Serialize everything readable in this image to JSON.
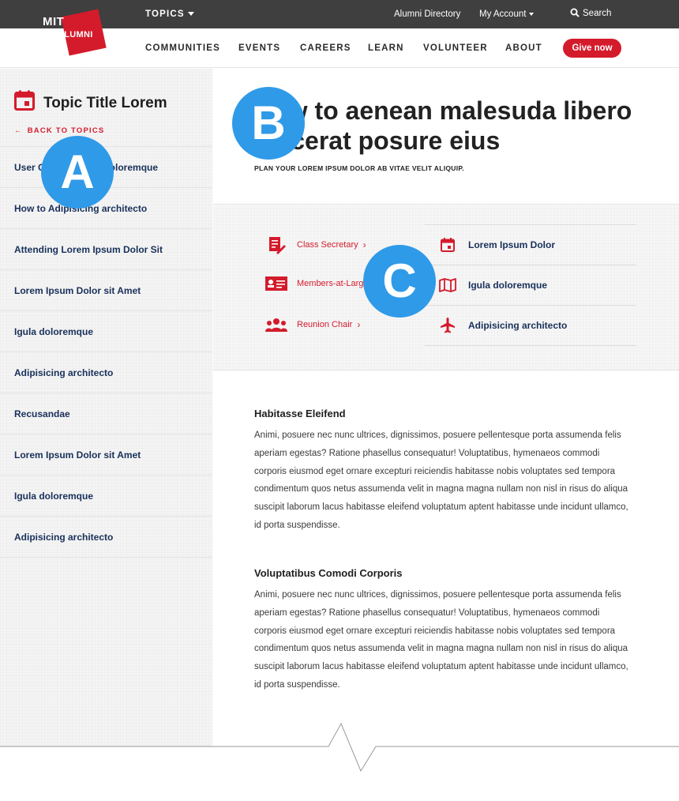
{
  "header": {
    "topics_label": "TOPICS",
    "alumni_directory": "Alumni Directory",
    "my_account": "My Account",
    "search": "Search",
    "logo_mit": "MIT",
    "logo_alumni": "ALUMNI"
  },
  "nav": {
    "items": [
      "COMMUNITIES",
      "EVENTS",
      "CAREERS",
      "LEARN",
      "VOLUNTEER",
      "ABOUT"
    ],
    "give_label": "Give now"
  },
  "sidebar": {
    "title": "Topic Title Lorem",
    "back": "BACK TO TOPICS",
    "items": [
      "User Guide to Igula doloremque",
      "How to Adipisicing architecto",
      "Attending Lorem Ipsum Dolor Sit",
      "Lorem Ipsum Dolor sit Amet",
      "Igula doloremque",
      "Adipisicing architecto",
      "Recusandae",
      "Lorem Ipsum Dolor sit Amet",
      "Igula doloremque",
      "Adipisicing architecto"
    ]
  },
  "hero": {
    "title": "How to aenean malesuda libero placerat posure eius",
    "subtitle": "PLAN YOUR LOREM IPSUM DOLOR AB VITAE VELIT ALIQUIP."
  },
  "links": {
    "roles": [
      {
        "label": "Class Secretary",
        "icon": "document-pen-icon"
      },
      {
        "label": "Members-at-Large",
        "icon": "id-card-icon"
      },
      {
        "label": "Reunion Chair",
        "icon": "group-icon"
      }
    ],
    "resources": [
      {
        "label": "Lorem Ipsum Dolor",
        "icon": "calendar-icon"
      },
      {
        "label": "Igula doloremque",
        "icon": "map-icon"
      },
      {
        "label": "Adipisicing architecto",
        "icon": "airplane-icon"
      }
    ]
  },
  "article": {
    "sections": [
      {
        "heading": "Habitasse Eleifend",
        "body": "Animi, posuere nec nunc ultrices, dignissimos, posuere pellentesque porta assumenda felis aperiam egestas? Ratione phasellus consequatur! Voluptatibus, hymenaeos commodi corporis eiusmod eget ornare excepturi reiciendis habitasse nobis voluptates sed tempora condimentum quos netus assumenda velit in magna magna nullam non nisl in risus do aliqua suscipit laborum lacus habitasse eleifend voluptatum aptent habitasse unde incidunt ullamco, id porta suspendisse."
      },
      {
        "heading": "Voluptatibus Comodi Corporis",
        "body": "Animi, posuere nec nunc ultrices, dignissimos, posuere pellentesque porta assumenda felis aperiam egestas? Ratione phasellus consequatur! Voluptatibus, hymenaeos commodi corporis eiusmod eget ornare excepturi reiciendis habitasse nobis voluptates sed tempora condimentum quos netus assumenda velit in magna magna nullam non nisl in risus do aliqua suscipit laborum lacus habitasse eleifend voluptatum aptent habitasse unde incidunt ullamco, id porta suspendisse."
      }
    ]
  },
  "markers": [
    "A",
    "B",
    "C"
  ],
  "colors": {
    "brand_red": "#d41b2c",
    "link_navy": "#18305a",
    "topbar": "#3f3f3f",
    "marker_blue": "#2f9ae8"
  }
}
